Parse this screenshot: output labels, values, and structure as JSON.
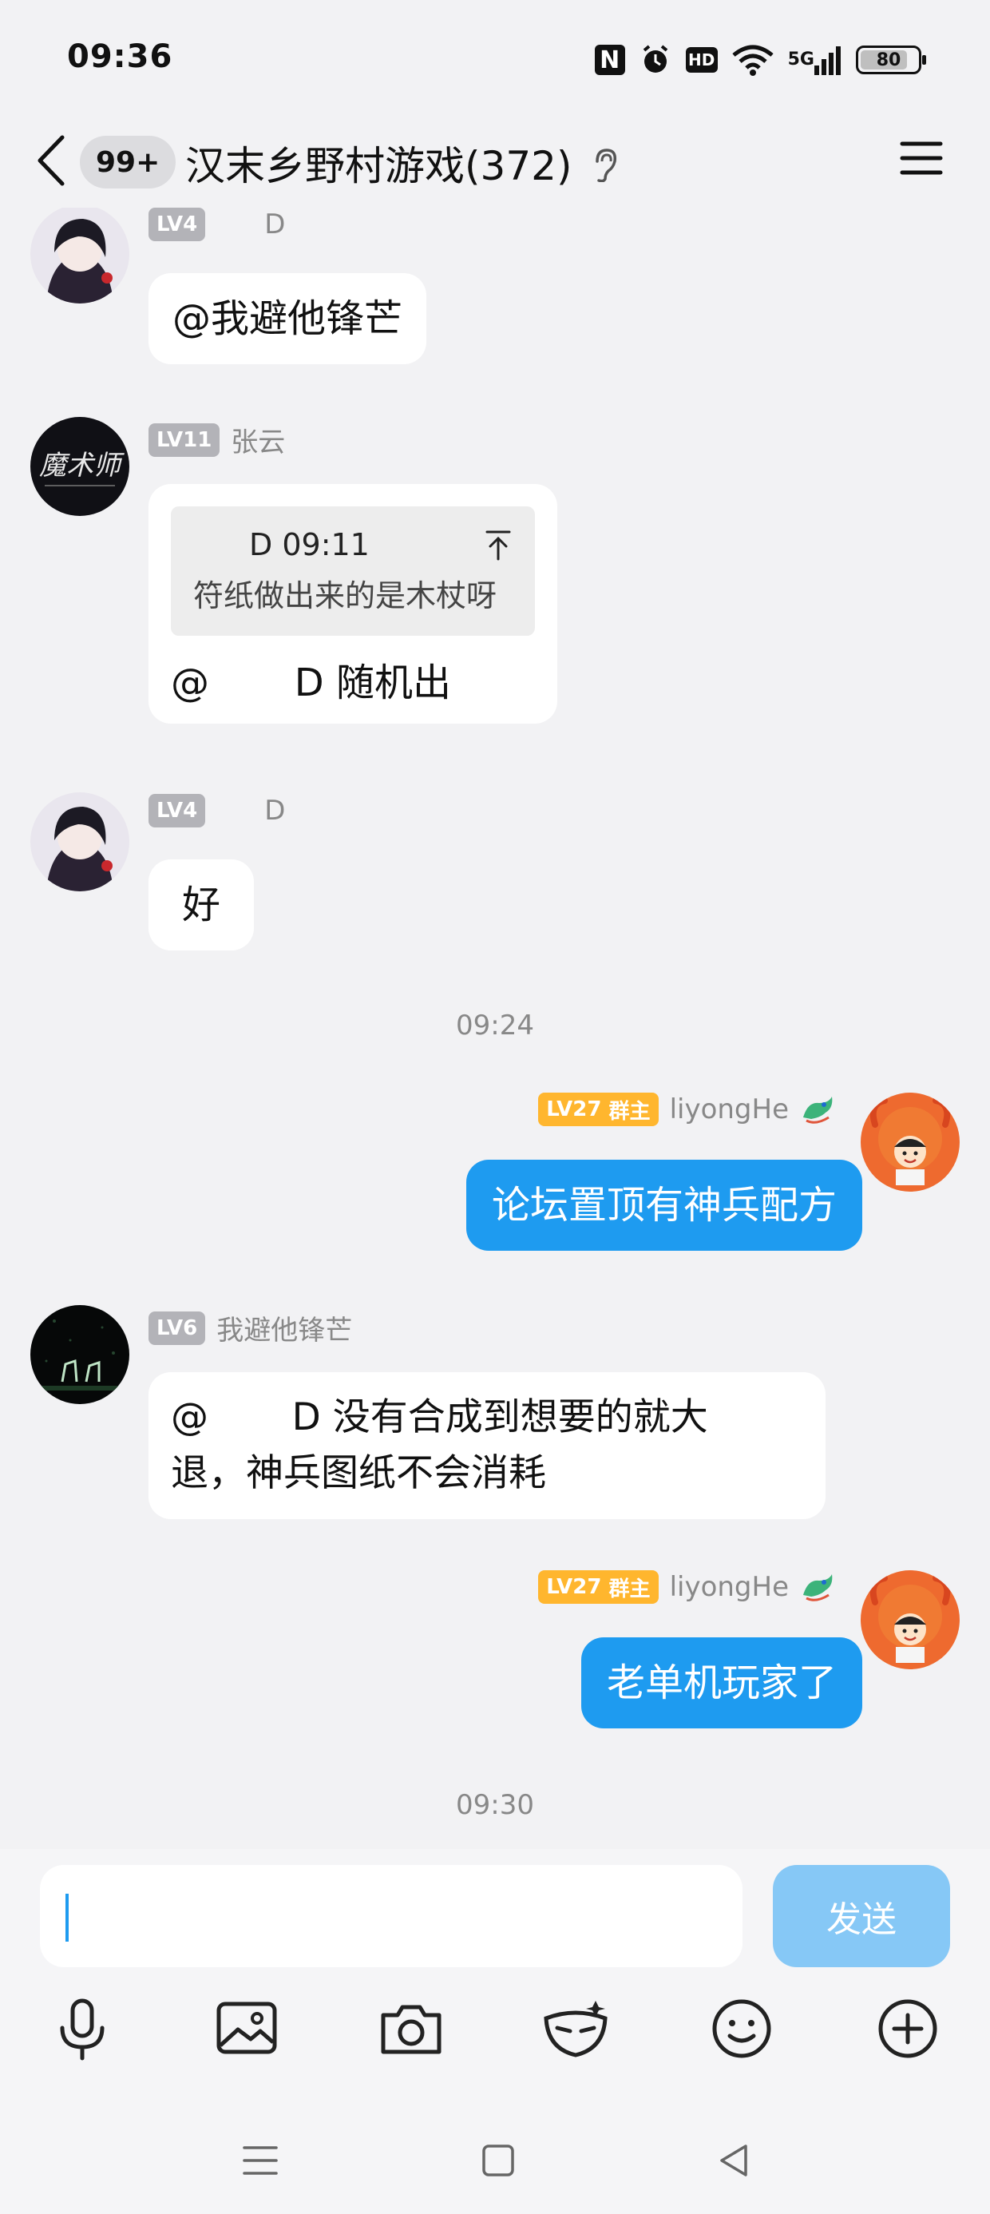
{
  "status_bar": {
    "time": "09:36",
    "nfc_label": "N",
    "hd_label": "HD",
    "network_label": "5G",
    "battery_level": "80"
  },
  "header": {
    "unread_badge": "99+",
    "title": "汉末乡野村游戏(372)"
  },
  "messages": [
    {
      "level": "LV4",
      "name": "D",
      "text": "@我避他锋芒"
    },
    {
      "level": "LV11",
      "name": "张云",
      "quote_header": "D 09:11",
      "quote_text": "符纸做出来的是木杖呀",
      "text": "@       D 随机出"
    },
    {
      "level": "LV4",
      "name": "D",
      "text": "好"
    },
    {
      "timestamp": "09:24"
    },
    {
      "level": "LV27",
      "role": "群主",
      "name": "liyongHe",
      "text": "论坛置顶有神兵配方"
    },
    {
      "level": "LV6",
      "name": "我避他锋芒",
      "text_line1": "@       D 没有合成到想要的就大",
      "text_line2": "退，神兵图纸不会消耗"
    },
    {
      "level": "LV27",
      "role": "群主",
      "name": "liyongHe",
      "text": "老单机玩家了"
    },
    {
      "timestamp": "09:30"
    }
  ],
  "input": {
    "value": "",
    "send_label": "发送"
  },
  "toolbar_icons": [
    "microphone-icon",
    "image-icon",
    "camera-icon",
    "mask-icon",
    "emoji-icon",
    "plus-icon"
  ],
  "colors": {
    "my_bubble": "#1e9bf0",
    "send_button": "#86c8f6",
    "owner_badge": "#ffb62e",
    "level_badge": "#b3b3b8",
    "background": "#f2f2f4"
  }
}
